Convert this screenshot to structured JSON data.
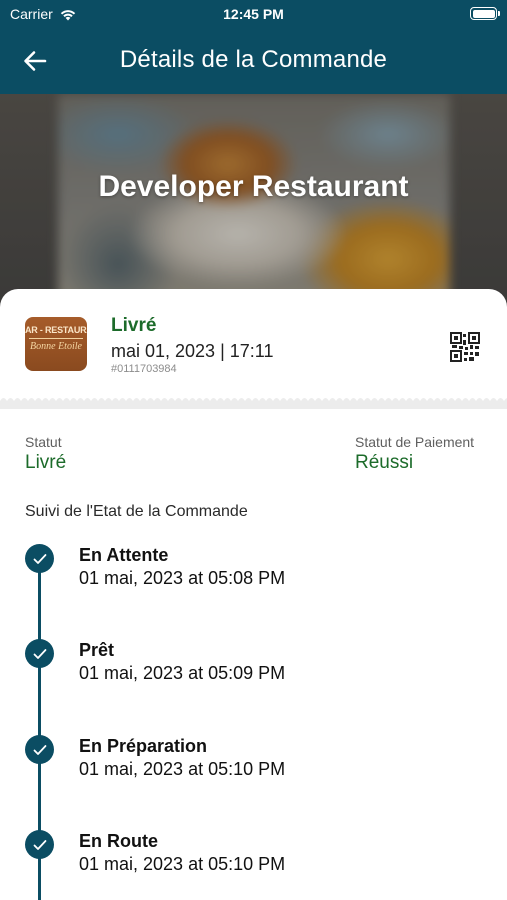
{
  "status_bar": {
    "carrier": "Carrier",
    "time": "12:45 PM",
    "icons": [
      "wifi-icon",
      "battery-icon"
    ]
  },
  "header": {
    "title": "Détails de la Commande",
    "back_icon": "arrow-left-icon"
  },
  "hero": {
    "restaurant_name": "Developer Restaurant"
  },
  "order": {
    "logo": {
      "top_text": "AR - RESTAURANT",
      "bottom_text": "Bonne Etoile"
    },
    "status": "Livré",
    "date": "mai 01, 2023 | 17:11",
    "id": "#0111703984",
    "qr_icon": "qr-code-icon"
  },
  "info": {
    "status_label": "Statut",
    "status_value": "Livré",
    "payment_label": "Statut de Paiement",
    "payment_value": "Réussi"
  },
  "tracking": {
    "title": "Suivi de l'Etat de la Commande",
    "steps": [
      {
        "name": "En Attente",
        "time": "01 mai, 2023 at 05:08 PM"
      },
      {
        "name": "Prêt",
        "time": "01 mai, 2023 at 05:09 PM"
      },
      {
        "name": "En Préparation",
        "time": "01 mai, 2023 at 05:10 PM"
      },
      {
        "name": "En Route",
        "time": "01 mai, 2023 at 05:10 PM"
      }
    ]
  },
  "colors": {
    "primary": "#0b4d63",
    "success": "#1c6b2a",
    "muted": "#8c8c8c"
  }
}
